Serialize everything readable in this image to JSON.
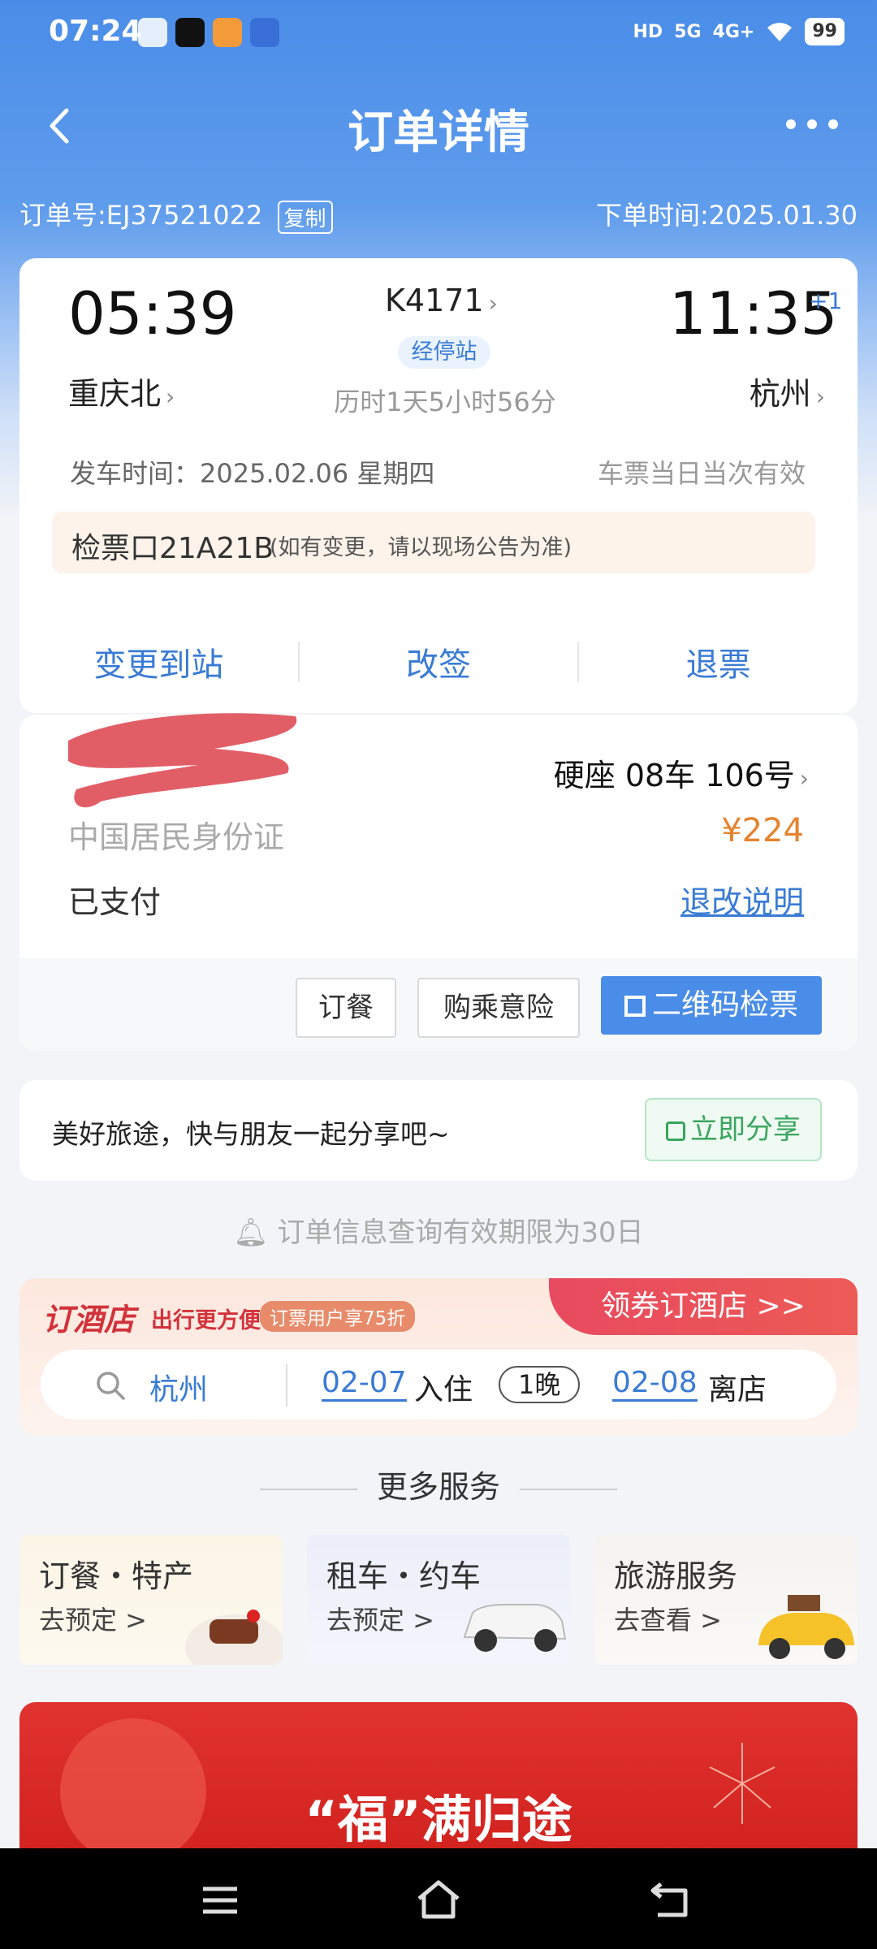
{
  "status_bar": {
    "time": "07:24",
    "battery": "99",
    "signal1": "5G",
    "signal2": "4G+"
  },
  "header": {
    "title": "订单详情"
  },
  "order": {
    "number": "订单号:EJ37521022",
    "copy_label": "复制",
    "order_time": "下单时间:2025.01.30"
  },
  "trip": {
    "depart_time": "05:39",
    "train_no": "K4171",
    "stops_label": "经停站",
    "duration": "历时1天5小时56分",
    "arrive_time": "11:35",
    "day_offset": "+1",
    "from_station": "重庆北",
    "to_station": "杭州",
    "depart_date": "发车时间：2025.02.06 星期四",
    "validity": "车票当日当次有效",
    "gate": "检票口21A21B",
    "gate_note": "(如有变更，请以现场公告为准)"
  },
  "trip_actions": {
    "change_station": "变更到站",
    "reschedule": "改签",
    "refund": "退票"
  },
  "passenger": {
    "seat": "硬座 08车 106号",
    "id_type": "中国居民身份证",
    "price": "¥224",
    "pay_status": "已支付",
    "refund_rules": "退改说明",
    "btn_meal": "订餐",
    "btn_insurance": "购乘意险",
    "btn_qrcode": "二维码检票"
  },
  "share": {
    "text": "美好旅途，快与朋友一起分享吧~",
    "button": "立即分享"
  },
  "notice": "订单信息查询有效期限为30日",
  "hotel": {
    "brand": "订酒店",
    "brand_sub": "出行更方便",
    "badge": "订票用户享75折",
    "cta": "领券订酒店 >>",
    "city": "杭州",
    "checkin_date": "02-07",
    "checkin_label": "入住",
    "nights": "1晚",
    "checkout_date": "02-08",
    "checkout_label": "离店"
  },
  "more_services": {
    "title": "更多服务",
    "items": [
      {
        "title": "订餐・特产",
        "sub": "去预定 >"
      },
      {
        "title": "租车・约车",
        "sub": "去预定 >"
      },
      {
        "title": "旅游服务",
        "sub": "去查看 >"
      }
    ]
  },
  "banner": {
    "text": "“福”满归途"
  }
}
